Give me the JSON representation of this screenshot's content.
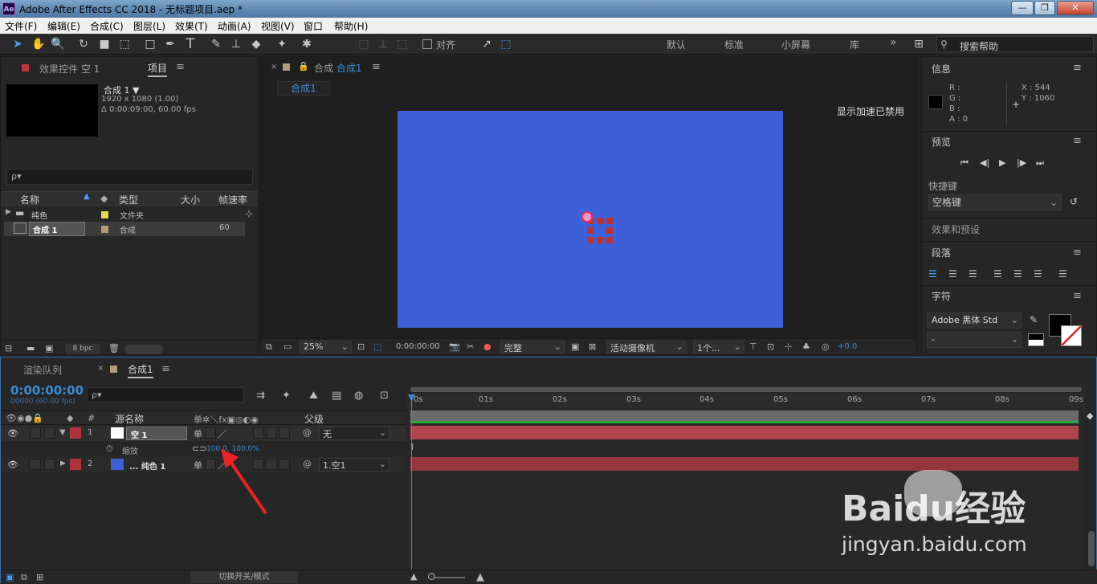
{
  "window": {
    "app_icon": "Ae",
    "title": "Adobe After Effects CC 2018 - 无标题项目.aep *",
    "min": "—",
    "max": "❐",
    "close": "✕"
  },
  "menu": [
    "文件(F)",
    "编辑(E)",
    "合成(C)",
    "图层(L)",
    "效果(T)",
    "动画(A)",
    "视图(V)",
    "窗口",
    "帮助(H)"
  ],
  "toolbar": {
    "align_label": "对齐",
    "workspaces": [
      "默认",
      "标准",
      "小屏幕",
      "库"
    ],
    "more": "»",
    "search_placeholder": "搜索帮助"
  },
  "project": {
    "tab_effects": "效果控件 空 1",
    "tab_project": "项目",
    "comp_name": "合成 1 ▼",
    "comp_size": "1920 x 1080 (1.00)",
    "comp_duration": "Δ 0:00:09:00, 60.00 fps",
    "search_placeholder": "ρ▾",
    "columns": [
      "名称",
      "类型",
      "大小",
      "帧速率"
    ],
    "items": [
      {
        "name": "纯色",
        "type": "文件夹",
        "rate": ""
      },
      {
        "name": "合成 1",
        "type": "合成",
        "rate": "60"
      }
    ],
    "bpc": "8 bpc"
  },
  "composition": {
    "tab": "合成 合成1",
    "tab_prefix": "合成",
    "tab_name": "合成1",
    "sub_tab": "合成1",
    "accel_msg": "显示加速已禁用",
    "zoom": "25%",
    "timecode": "0:00:00:00",
    "quality": "完整",
    "camera": "活动摄像机",
    "views": "1个...",
    "exposure": "+0.0",
    "bg_color": "#3d5fd8"
  },
  "info": {
    "title": "信息",
    "r": "R :",
    "g": "G :",
    "b": "B :",
    "a": "A : 0",
    "x": "X : 544",
    "y": "Y : 1060"
  },
  "preview": {
    "title": "预览",
    "shortcut_label": "快捷键",
    "shortcut_value": "空格键"
  },
  "effects": {
    "title": "效果和预设"
  },
  "paragraph": {
    "title": "段落"
  },
  "character": {
    "title": "字符",
    "font": "Adobe 黑体 Std",
    "style": "-"
  },
  "timeline": {
    "tab_render": "渲染队列",
    "tab_comp": "合成1",
    "timecode": "0:00:00:00",
    "frames": "00000 (60.00 fps)",
    "search_placeholder": "ρ▾",
    "header": {
      "num": "#",
      "src": "源名称",
      "parent": "父级"
    },
    "layers": [
      {
        "num": "1",
        "name": "空 1",
        "color": "#ffffff",
        "parent": "无",
        "label": "#b0323a"
      },
      {
        "num": "2",
        "name": "... 纯色 1",
        "color": "#3d5fd8",
        "parent": "1.空1",
        "label": "#b0323a"
      }
    ],
    "prop_name": "缩放",
    "prop_value": "100.0, 100.0%",
    "ruler": [
      "0s",
      "01s",
      "02s",
      "03s",
      "04s",
      "05s",
      "06s",
      "07s",
      "08s",
      "09s"
    ],
    "toggle": "切换开关/模式"
  },
  "watermark": {
    "line1": "Baidu经验",
    "line2": "jingyan.baidu.com"
  }
}
